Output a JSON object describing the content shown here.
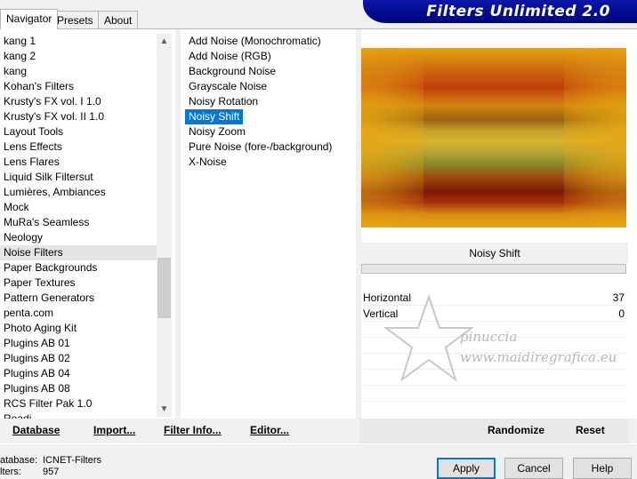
{
  "tabs": [
    "Navigator",
    "Presets",
    "About"
  ],
  "banner_title": "Filters Unlimited 2.0",
  "categories": [
    "kang 1",
    "kang 2",
    "kang",
    "Kohan's Filters",
    "Krusty's FX vol. I 1.0",
    "Krusty's FX vol. II 1.0",
    "Layout Tools",
    "Lens Effects",
    "Lens Flares",
    "Liquid Silk Filtersut",
    "Lumières, Ambiances",
    "Mock",
    "MuRa's Seamless",
    "Neology",
    "Noise Filters",
    "Paper Backgrounds",
    "Paper Textures",
    "Pattern Generators",
    "penta.com",
    "Photo Aging Kit",
    "Plugins AB 01",
    "Plugins AB 02",
    "Plugins AB 04",
    "Plugins AB 08",
    "RCS Filter Pak 1.0",
    "Readi"
  ],
  "highlighted_category": "Noise Filters",
  "filters": [
    "Add Noise (Monochromatic)",
    "Add Noise (RGB)",
    "Background Noise",
    "Grayscale Noise",
    "Noisy Rotation",
    "Noisy Shift",
    "Noisy Zoom",
    "Pure Noise (fore-/background)",
    "X-Noise"
  ],
  "selected_filter": "Noisy Shift",
  "scroll_icons": {
    "up": "chevron-up-icon",
    "down": "chevron-down-icon"
  },
  "preview": {
    "filter_name": "Noisy Shift"
  },
  "parameters": [
    {
      "label": "Horizontal",
      "value": "37"
    },
    {
      "label": "Vertical",
      "value": "0"
    }
  ],
  "watermark": {
    "line1": "pinuccia",
    "line2": "www.maidiregrafica.eu"
  },
  "bottom_links": {
    "database": "Database",
    "import": "Import...",
    "filter_info": "Filter Info...",
    "editor": "Editor...",
    "randomize": "Randomize",
    "reset": "Reset"
  },
  "status": {
    "database_label": "atabase:",
    "database_value": "ICNET-Filters",
    "filters_label": "lters:",
    "filters_value": "957"
  },
  "buttons": {
    "apply": "Apply",
    "cancel": "Cancel",
    "help": "Help"
  },
  "colors": {
    "selection": "#0078d7",
    "banner": "#0c16a8"
  }
}
